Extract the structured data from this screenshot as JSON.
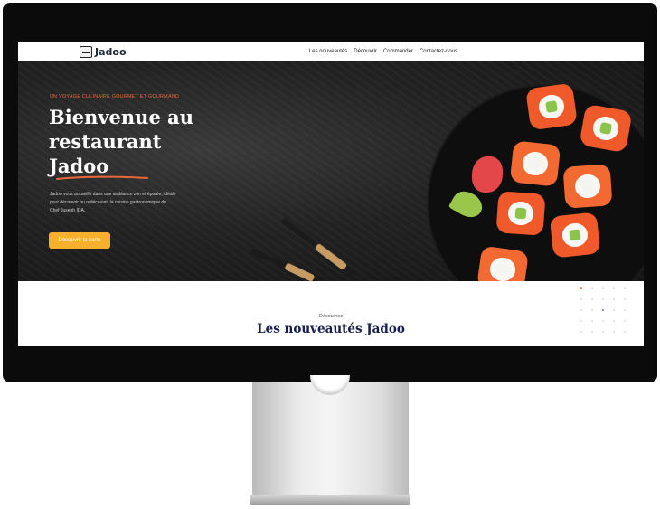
{
  "navbar": {
    "logo_text": "Jadoo",
    "links": [
      "Les nouveautés",
      "Découvrir",
      "Commander",
      "Contactez-nous"
    ]
  },
  "hero": {
    "eyebrow": "UN VOYAGE CULINAIRE GOURMET ET GOURMAND",
    "title_line1": "Bienvenue au",
    "title_line2": "restaurant",
    "title_line3": "Jadoo",
    "body": "Jadoo vous accueille dans une ambiance zen et épurée, idéale pour découvrir ou redécouvrir la cuisine gastronomique du Chef Juseph IDA.",
    "cta_label": "Découvrir la carte"
  },
  "section": {
    "label": "Découvrez",
    "title": "Les nouveautés Jadoo"
  },
  "colors": {
    "accent": "#f6b02c",
    "eyebrow": "#e9673a",
    "title_dark": "#181e4b"
  }
}
